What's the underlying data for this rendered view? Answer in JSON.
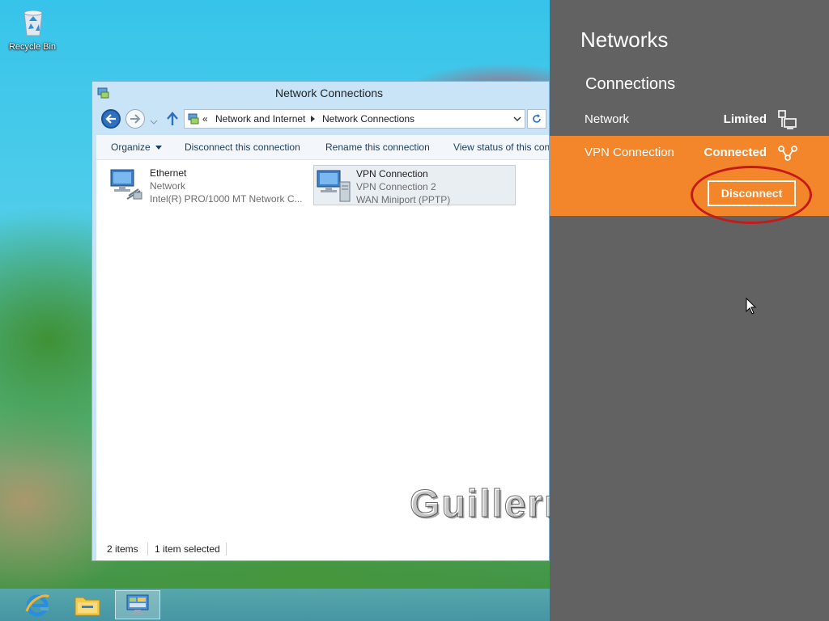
{
  "desktop": {
    "recycle_bin_label": "Recycle Bin"
  },
  "explorer": {
    "title": "Network Connections",
    "address": {
      "overflow": "«",
      "crumbs": [
        "Network and Internet",
        "Network Connections"
      ]
    },
    "commands": {
      "organize": "Organize",
      "disconnect": "Disconnect this connection",
      "rename": "Rename this connection",
      "view_status": "View status of this connection"
    },
    "items": [
      {
        "name": "Ethernet",
        "type": "Network",
        "device": "Intel(R) PRO/1000 MT Network C..."
      },
      {
        "name": "VPN Connection",
        "type": "VPN Connection  2",
        "device": "WAN Miniport (PPTP)",
        "selected": true
      }
    ],
    "status": {
      "count": "2 items",
      "selection": "1 item selected"
    }
  },
  "watermark": "GuillermoD",
  "networks_panel": {
    "title": "Networks",
    "section": "Connections",
    "connections": [
      {
        "name": "Network",
        "status": "Limited",
        "icon": "wired-network-icon"
      },
      {
        "name": "VPN Connection",
        "status": "Connected",
        "icon": "vpn-icon"
      }
    ],
    "disconnect_label": "Disconnect",
    "colors": {
      "panel_bg": "#626262",
      "selected_bg": "#f3852a",
      "highlight_ring": "#c51a1a"
    }
  }
}
